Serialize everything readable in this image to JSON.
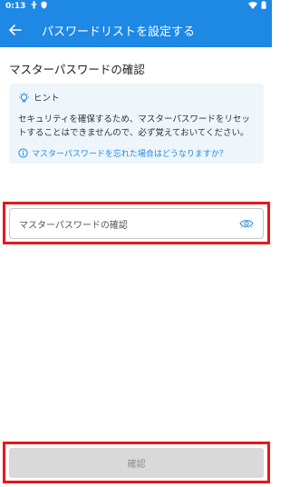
{
  "statusbar": {
    "time": "0:13"
  },
  "appbar": {
    "title": "パスワードリストを設定する"
  },
  "page": {
    "section_title": "マスターパスワードの確認"
  },
  "hint": {
    "label": "ヒント",
    "body": "セキュリティを確保するため、マスターパスワードをリセットすることはできませんので、必ず覚えておいてください。",
    "link": "マスターパスワードを忘れた場合はどうなりますか？"
  },
  "field": {
    "placeholder": "マスターパスワードの確認"
  },
  "confirm_button": {
    "label": "確認"
  },
  "colors": {
    "accent": "#1e88e5",
    "highlight": "#e8171a",
    "hint_bg": "#eef6fb",
    "button_disabled": "#d9d9d9"
  },
  "icons": [
    "back-arrow-icon",
    "lightbulb-icon",
    "info-icon",
    "eye-icon",
    "wifi-icon",
    "battery-icon"
  ]
}
